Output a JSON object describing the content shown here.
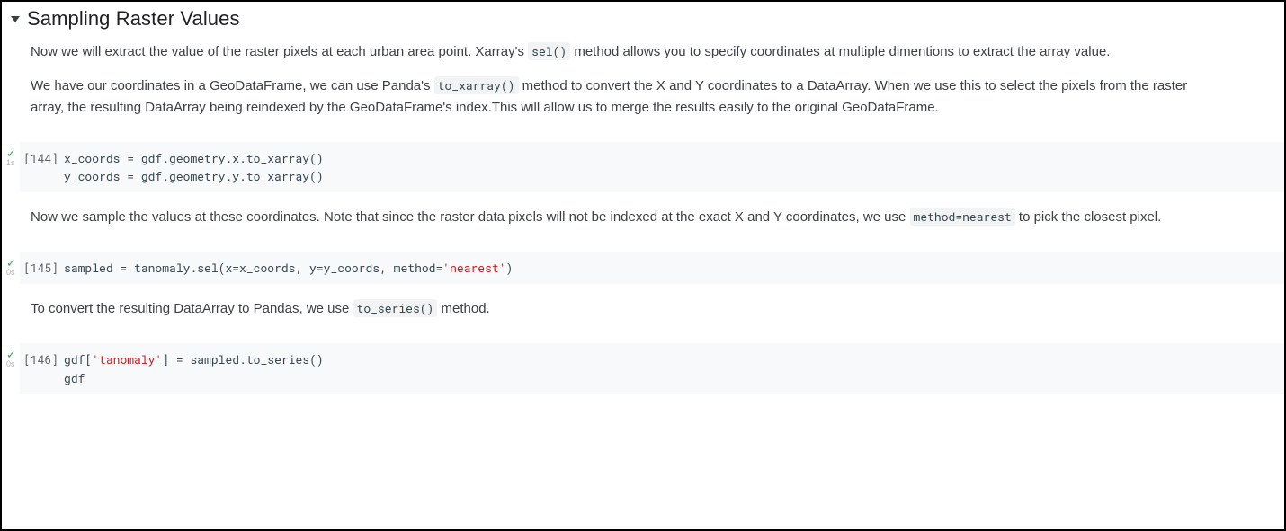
{
  "section": {
    "title": "Sampling Raster Values"
  },
  "para1": {
    "t1": "Now we will extract the value of the raster pixels at each urban area point. Xarray's ",
    "c1": "sel()",
    "t2": " method allows you to specify coordinates at multiple dimentions to extract the array value."
  },
  "para2": {
    "t1": "We have our coordinates in a GeoDataFrame, we can use Panda's ",
    "c1": "to_xarray()",
    "t2": " method to convert the X and Y coordinates to a DataArray. When we use this to select the pixels from the raster array, the resulting DataArray being reindexed by the GeoDataFrame's index.This will allow us to merge the results easily to the original GeoDataFrame."
  },
  "para3": {
    "t1": "Now we sample the values at these coordinates. Note that since the raster data pixels will not be indexed at the exact X and Y coordinates, we use ",
    "c1": "method=nearest",
    "t2": " to pick the closest pixel."
  },
  "para4": {
    "t1": "To convert the resulting DataArray to Pandas, we use ",
    "c1": "to_series()",
    "t2": " method."
  },
  "cells": {
    "c1": {
      "num": "[144]",
      "dur": "1s",
      "code_plain": "x_coords = gdf.geometry.x.to_xarray()\ny_coords = gdf.geometry.y.to_xarray()"
    },
    "c2": {
      "num": "[145]",
      "dur": "0s",
      "code_pre": "sampled = tanomaly.sel(x=x_coords, y=y_coords, method=",
      "code_str": "'nearest'",
      "code_post": ")"
    },
    "c3": {
      "num": "[146]",
      "dur": "0s",
      "code_l1a": "gdf[",
      "code_l1s": "'tanomaly'",
      "code_l1b": "] = sampled.to_series()",
      "code_l2": "gdf"
    }
  }
}
